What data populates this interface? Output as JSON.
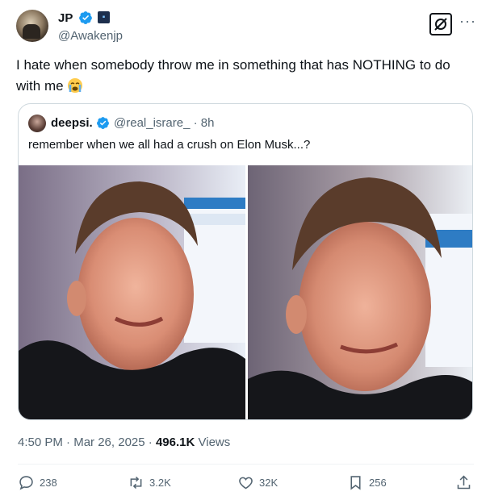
{
  "author": {
    "name": "JP",
    "handle": "@Awakenjp"
  },
  "tweet": {
    "text": "I hate when somebody throw me in something that has NOTHING to do with me"
  },
  "quoted": {
    "name": "deepsi.",
    "handle": "@real_israre_",
    "separator": "·",
    "time": "8h",
    "text": "remember when we all had a crush on Elon Musk...?"
  },
  "meta": {
    "time": "4:50 PM",
    "separator1": "·",
    "date": "Mar 26, 2025",
    "separator2": "·",
    "views_count": "496.1K",
    "views_label": "Views"
  },
  "actions": {
    "replies": "238",
    "reposts": "3.2K",
    "likes": "32K",
    "bookmarks": "256"
  },
  "colors": {
    "verified": "#1d9bf0",
    "muted": "#536471",
    "text": "#0f1419",
    "border": "#cfd9de"
  }
}
